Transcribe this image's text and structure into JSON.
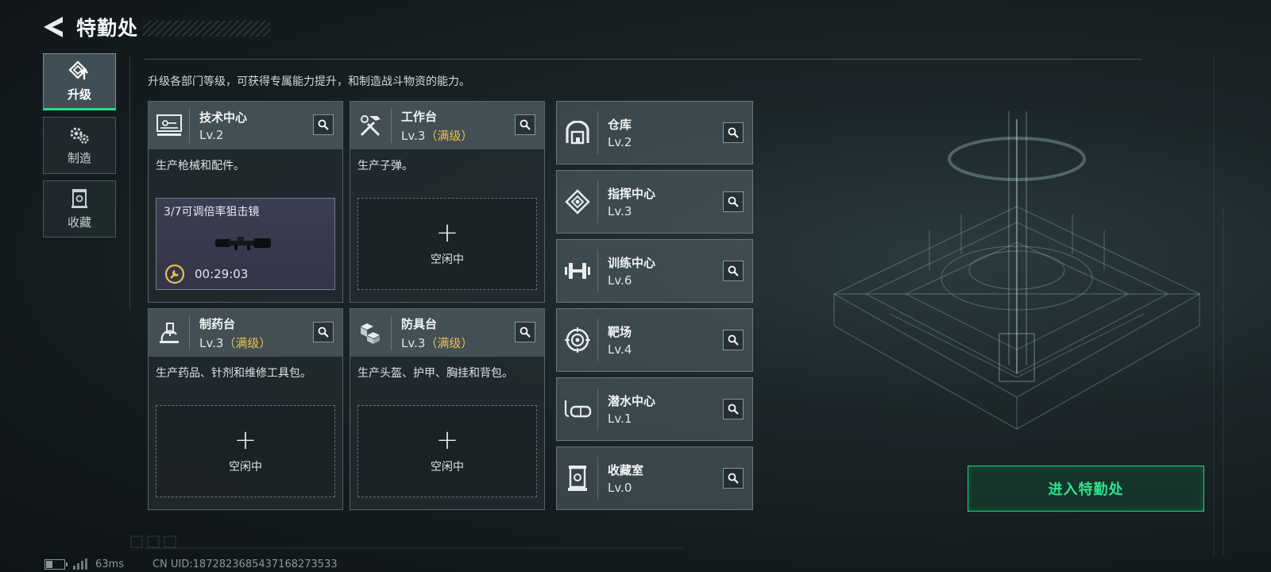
{
  "header": {
    "title": "特勤处"
  },
  "nav": {
    "tabs": [
      {
        "label": "升级",
        "icon": "upgrade-icon",
        "active": true
      },
      {
        "label": "制造",
        "icon": "gears-icon",
        "active": false
      },
      {
        "label": "收藏",
        "icon": "collection-icon",
        "active": false
      }
    ]
  },
  "subtitle": "升级各部门等级，可获得专属能力提升，和制造战斗物资的能力。",
  "production_cards": [
    {
      "name": "技术中心",
      "level": "Lv.2",
      "maxed": "",
      "icon": "tech-center-icon",
      "desc": "生产枪械和配件。",
      "slot": {
        "state": "active",
        "item": "3/7可调倍率狙击镜",
        "timer": "00:29:03"
      }
    },
    {
      "name": "工作台",
      "level": "Lv.3",
      "maxed": "（满级）",
      "icon": "workbench-icon",
      "desc": "生产子弹。",
      "slot": {
        "state": "empty",
        "label": "空闲中"
      }
    },
    {
      "name": "制药台",
      "level": "Lv.3",
      "maxed": "（满级）",
      "icon": "pharmacy-icon",
      "desc": "生产药品、针剂和维修工具包。",
      "slot": {
        "state": "empty",
        "label": "空闲中"
      }
    },
    {
      "name": "防具台",
      "level": "Lv.3",
      "maxed": "（满级）",
      "icon": "armor-bench-icon",
      "desc": "生产头盔、护甲、胸挂和背包。",
      "slot": {
        "state": "empty",
        "label": "空闲中"
      }
    }
  ],
  "facility_cards": [
    {
      "name": "仓库",
      "level": "Lv.2",
      "icon": "warehouse-icon"
    },
    {
      "name": "指挥中心",
      "level": "Lv.3",
      "icon": "command-center-icon"
    },
    {
      "name": "训练中心",
      "level": "Lv.6",
      "icon": "dumbbell-icon"
    },
    {
      "name": "靶场",
      "level": "Lv.4",
      "icon": "target-icon"
    },
    {
      "name": "潜水中心",
      "level": "Lv.1",
      "icon": "diving-mask-icon"
    },
    {
      "name": "收藏室",
      "level": "Lv.0",
      "icon": "collection-room-icon"
    }
  ],
  "enter_button": "进入特勤处",
  "footer": {
    "ping": "63ms",
    "uid": "CN UID:1872823685437168273533"
  },
  "colors": {
    "accent": "#1ee08e",
    "maxed": "#e8c04a"
  }
}
